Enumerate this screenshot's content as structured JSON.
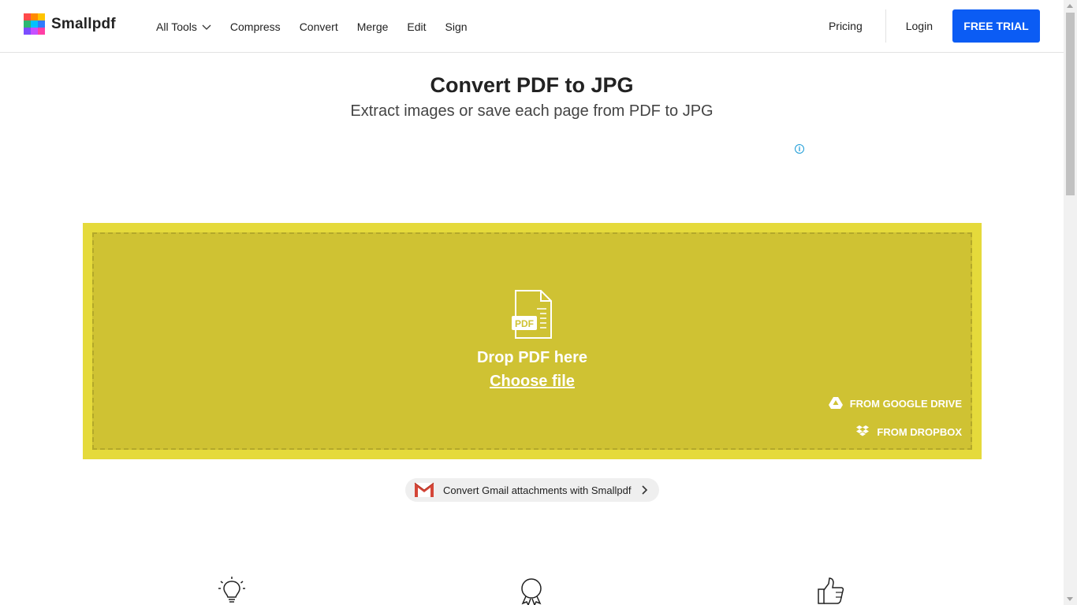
{
  "header": {
    "logo_text": "Smallpdf",
    "nav": [
      {
        "label": "All Tools"
      },
      {
        "label": "Compress"
      },
      {
        "label": "Convert"
      },
      {
        "label": "Merge"
      },
      {
        "label": "Edit"
      },
      {
        "label": "Sign"
      }
    ],
    "pricing": "Pricing",
    "login": "Login",
    "trial": "FREE TRIAL"
  },
  "hero": {
    "title": "Convert PDF to JPG",
    "subtitle": "Extract images or save each page from PDF to JPG"
  },
  "ad_info_icon": "info-icon",
  "dropzone": {
    "file_badge": "PDF",
    "drop_text": "Drop PDF here",
    "choose_file": "Choose file",
    "google_drive": "FROM GOOGLE DRIVE",
    "dropbox": "FROM DROPBOX"
  },
  "gmail": {
    "label": "Convert Gmail attachments with Smallpdf"
  },
  "features": [
    {
      "icon": "lightbulb-icon"
    },
    {
      "icon": "award-icon"
    },
    {
      "icon": "thumbs-up-icon"
    }
  ],
  "colors": {
    "accent": "#0b5cf4",
    "dropzone_outer": "#e5da3b",
    "dropzone_inner": "#cfc233"
  }
}
